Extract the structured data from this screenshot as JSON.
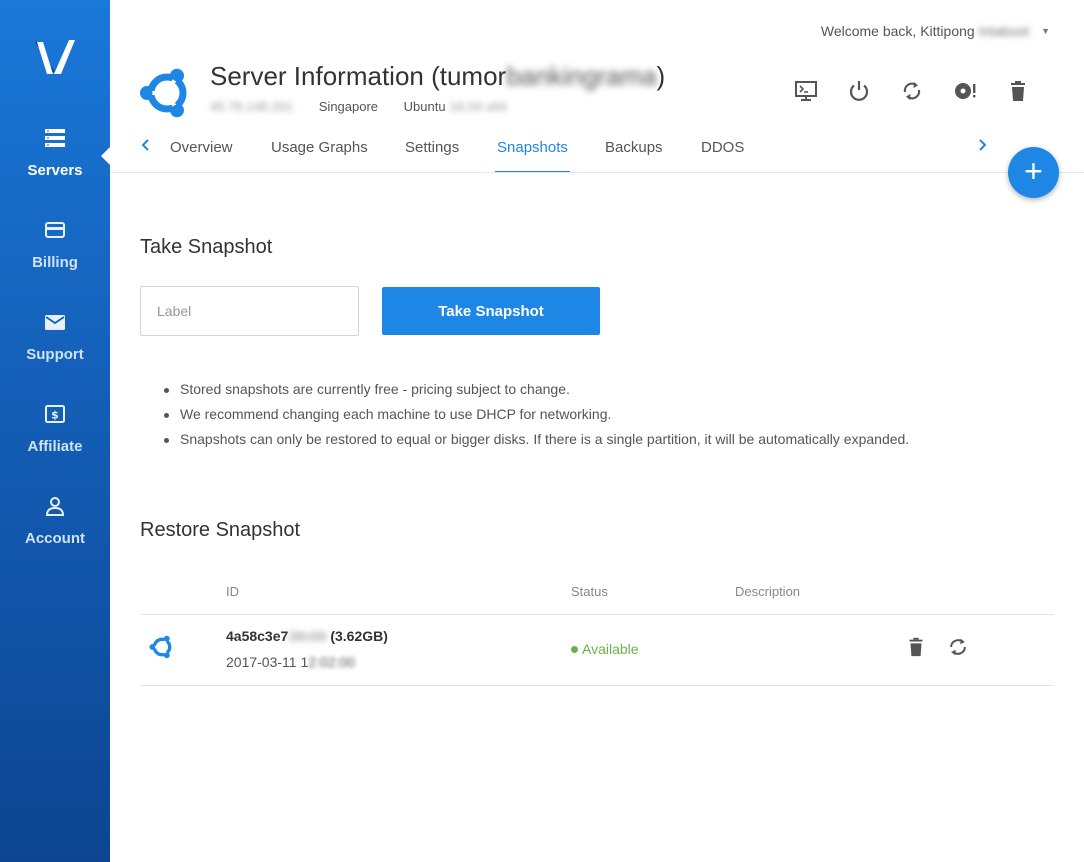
{
  "colors": {
    "accent": "#1e87e5",
    "sidebar": "#145fb8",
    "status_available": "#6ab04c"
  },
  "sidebar": {
    "logo_icon": "vultr-logo-icon",
    "items": [
      {
        "label": "Servers",
        "icon": "servers-icon",
        "active": true
      },
      {
        "label": "Billing",
        "icon": "credit-card-icon"
      },
      {
        "label": "Support",
        "icon": "envelope-icon"
      },
      {
        "label": "Affiliate",
        "icon": "dollar-bill-icon"
      },
      {
        "label": "Account",
        "icon": "user-icon"
      }
    ]
  },
  "header": {
    "welcome_prefix": "Welcome back, Kittipong",
    "welcome_redacted": "Intaboot",
    "title_prefix": "Server Information (tumor",
    "title_redacted": "bankingrama",
    "title_suffix": ")",
    "ip_redacted": "45.76.148.201",
    "location": "Singapore",
    "os": "Ubuntu",
    "os_version_redacted": "16.04 x64",
    "actions": [
      {
        "name": "console",
        "icon": "console-icon"
      },
      {
        "name": "power",
        "icon": "power-icon"
      },
      {
        "name": "restart",
        "icon": "restart-icon"
      },
      {
        "name": "reinstall",
        "icon": "disc-alert-icon"
      },
      {
        "name": "destroy",
        "icon": "trash-icon"
      }
    ]
  },
  "tabs": [
    {
      "label": "Overview"
    },
    {
      "label": "Usage Graphs"
    },
    {
      "label": "Settings"
    },
    {
      "label": "Snapshots",
      "active": true
    },
    {
      "label": "Backups"
    },
    {
      "label": "DDOS"
    }
  ],
  "fab_label": "+",
  "take_snapshot": {
    "heading": "Take Snapshot",
    "input_placeholder": "Label",
    "input_value": "",
    "button_label": "Take Snapshot",
    "notes": [
      "Stored snapshots are currently free - pricing subject to change.",
      "We recommend changing each machine to use DHCP for networking.",
      "Snapshots can only be restored to equal or bigger disks. If there is a single partition, it will be automatically expanded."
    ]
  },
  "restore_snapshot": {
    "heading": "Restore Snapshot",
    "columns": {
      "id": "ID",
      "status": "Status",
      "description": "Description"
    },
    "rows": [
      {
        "id_prefix": "4a58c3e7",
        "id_redacted": "38c68",
        "size": "(3.62GB)",
        "date_prefix": "2017-03-11 1",
        "date_redacted": "2:02:00",
        "status": "Available",
        "description": ""
      }
    ]
  }
}
